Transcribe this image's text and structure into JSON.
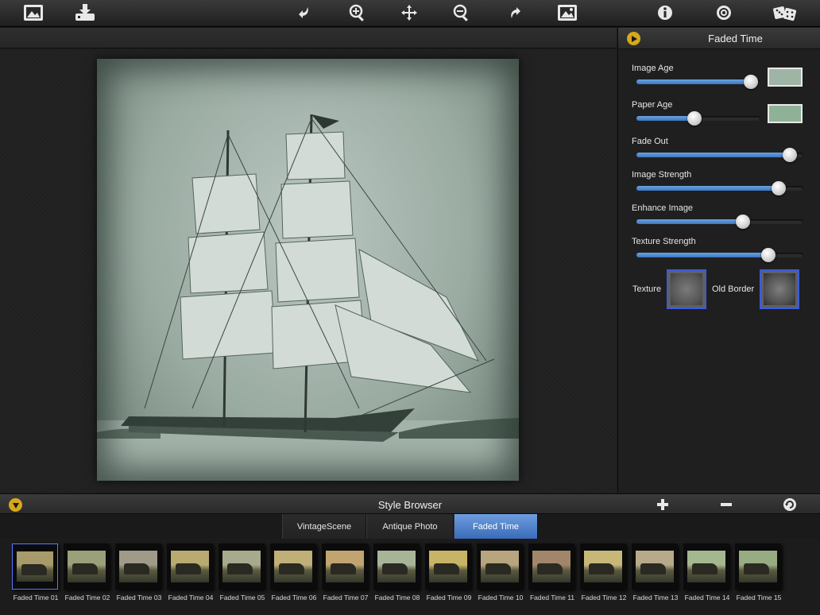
{
  "toolbar": {
    "icons": [
      "photo-library-icon",
      "save-download-icon",
      "undo-icon",
      "zoom-in-icon",
      "move-icon",
      "zoom-out-icon",
      "redo-icon",
      "compare-image-icon",
      "info-icon",
      "settings-icon",
      "random-dice-icon"
    ]
  },
  "panel": {
    "title": "Faded Time",
    "controls": [
      {
        "label": "Image Age",
        "value": 0.92,
        "swatch": "#9eb5a6"
      },
      {
        "label": "Paper Age",
        "value": 0.47,
        "swatch": "#8fb296"
      },
      {
        "label": "Fade Out",
        "value": 0.92
      },
      {
        "label": "Image Strength",
        "value": 0.85
      },
      {
        "label": "Enhance Image",
        "value": 0.64
      },
      {
        "label": "Texture Strength",
        "value": 0.79
      }
    ],
    "texture_label": "Texture",
    "old_border_label": "Old Border"
  },
  "browser": {
    "title": "Style Browser",
    "tabs": [
      {
        "label": "VintageScene",
        "active": false
      },
      {
        "label": "Antique Photo",
        "active": false
      },
      {
        "label": "Faded Time",
        "active": true
      }
    ],
    "presets": [
      {
        "label": "Faded Time 01",
        "tint": "#a89a6a"
      },
      {
        "label": "Faded Time 02",
        "tint": "#9aa078"
      },
      {
        "label": "Faded Time 03",
        "tint": "#a09a88"
      },
      {
        "label": "Faded Time 04",
        "tint": "#b9aa70"
      },
      {
        "label": "Faded Time 05",
        "tint": "#a7aa8c"
      },
      {
        "label": "Faded Time 06",
        "tint": "#c0b078"
      },
      {
        "label": "Faded Time 07",
        "tint": "#c2a470"
      },
      {
        "label": "Faded Time 08",
        "tint": "#a8b498"
      },
      {
        "label": "Faded Time 09",
        "tint": "#c8b466"
      },
      {
        "label": "Faded Time 10",
        "tint": "#b8a47e"
      },
      {
        "label": "Faded Time 11",
        "tint": "#a2866a"
      },
      {
        "label": "Faded Time 12",
        "tint": "#c8b878"
      },
      {
        "label": "Faded Time 13",
        "tint": "#b6aa8a"
      },
      {
        "label": "Faded Time 14",
        "tint": "#a4b890"
      },
      {
        "label": "Faded Time 15",
        "tint": "#98ac84"
      }
    ],
    "selected_index": 0
  }
}
